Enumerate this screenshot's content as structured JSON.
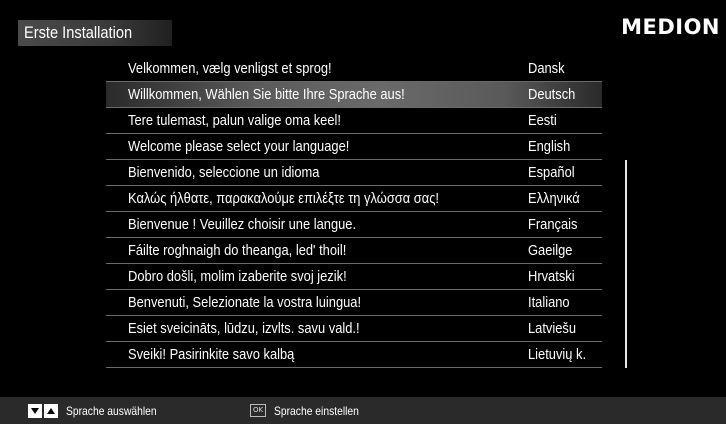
{
  "header": {
    "title": "Erste Installation",
    "brand": "MEDION"
  },
  "languages": [
    {
      "message": "Velkommen, vælg venligst et sprog!",
      "language": "Dansk"
    },
    {
      "message": "Willkommen, Wählen Sie bitte Ihre Sprache aus!",
      "language": "Deutsch",
      "selected": true
    },
    {
      "message": "Tere tulemast, palun valige oma keel!",
      "language": "Eesti"
    },
    {
      "message": "Welcome please select your language!",
      "language": "English"
    },
    {
      "message": "Bienvenido, seleccione un idioma",
      "language": "Español"
    },
    {
      "message": "Καλώς ήλθατε, παρακαλούμε επιλέξτε τη γλώσσα σας!",
      "language": "Ελληνικά"
    },
    {
      "message": "Bienvenue ! Veuillez choisir une langue.",
      "language": "Français"
    },
    {
      "message": "Fáilte roghnaigh do theanga, led' thoil!",
      "language": "Gaeilge"
    },
    {
      "message": "Dobro došli, molim izaberite svoj jezik!",
      "language": "Hrvatski"
    },
    {
      "message": "Benvenuti, Selezionate la vostra luingua!",
      "language": "Italiano"
    },
    {
      "message": "Esiet sveicināts, lūdzu, izvlts. savu vald.!",
      "language": "Latviešu"
    },
    {
      "message": "Sveiki! Pasirinkite savo kalbą",
      "language": "Lietuvių k."
    }
  ],
  "footer": {
    "select_hint": "Sprache auswählen",
    "ok_key": "OK",
    "confirm_hint": "Sprache einstellen"
  },
  "icons": {
    "down": "arrow-down-icon",
    "up": "arrow-up-icon",
    "ok": "ok-key-icon"
  },
  "colors": {
    "background": "#000000",
    "selected_row": "#6a6a6a",
    "footer": "#2a2a2a",
    "text": "#ffffff"
  }
}
